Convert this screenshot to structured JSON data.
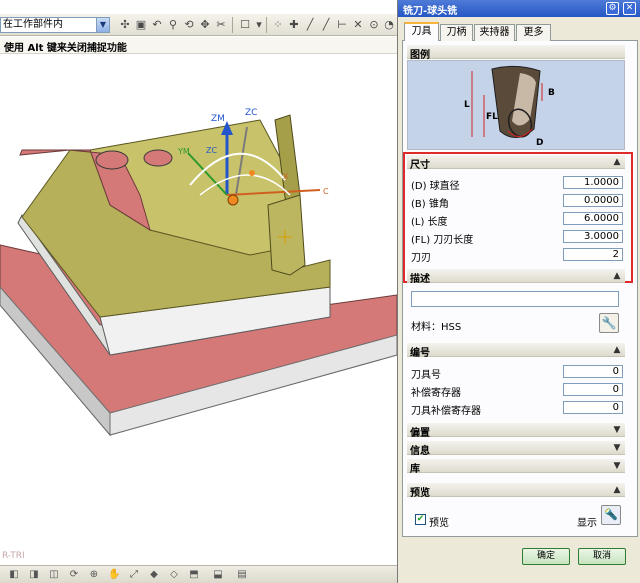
{
  "toolbar": {
    "filter_value": "在工作部件内"
  },
  "hint": {
    "text": "使用 Alt 键来关闭捕捉功能"
  },
  "viewport": {
    "view_label": "R-TRI",
    "axis_labels": {
      "zm": "ZM",
      "zc": "ZC",
      "ym": "YM",
      "zc2": "ZC",
      "x": "X",
      "c": "C"
    }
  },
  "dialog": {
    "title": "铣刀-球头铣",
    "tabs": [
      {
        "label": "刀具",
        "active": true
      },
      {
        "label": "刀柄",
        "active": false
      },
      {
        "label": "夹持器",
        "active": false
      },
      {
        "label": "更多",
        "active": false
      }
    ],
    "sections": {
      "figure": {
        "title": "图例",
        "labels": {
          "L": "L",
          "FL": "FL",
          "B": "B",
          "D": "D"
        }
      },
      "dimensions": {
        "title": "尺寸",
        "rows": [
          {
            "label": "(D) 球直径",
            "value": "1.0000"
          },
          {
            "label": "(B) 锥角",
            "value": "0.0000"
          },
          {
            "label": "(L) 长度",
            "value": "6.0000"
          },
          {
            "label": "(FL) 刀刃长度",
            "value": "3.0000"
          },
          {
            "label": "刀刃",
            "value": "2"
          }
        ]
      },
      "description": {
        "title": "描述",
        "value": "",
        "material_label": "材料：HSS"
      },
      "numbering": {
        "title": "编号",
        "rows": [
          {
            "label": "刀具号",
            "value": "0"
          },
          {
            "label": "补偿寄存器",
            "value": "0"
          },
          {
            "label": "刀具补偿寄存器",
            "value": "0"
          }
        ]
      },
      "offset": {
        "title": "偏置"
      },
      "info": {
        "title": "信息"
      },
      "library": {
        "title": "库"
      },
      "preview": {
        "title": "预览",
        "checkbox_label": "预览",
        "checked": true,
        "show_label": "显示"
      }
    },
    "buttons": {
      "ok": "确定",
      "cancel": "取消"
    }
  },
  "colors": {
    "title_bar": "#2456c4",
    "highlight_box": "#e02a2a",
    "part_face": "#c8c26a",
    "base_plate": "#d47878"
  }
}
